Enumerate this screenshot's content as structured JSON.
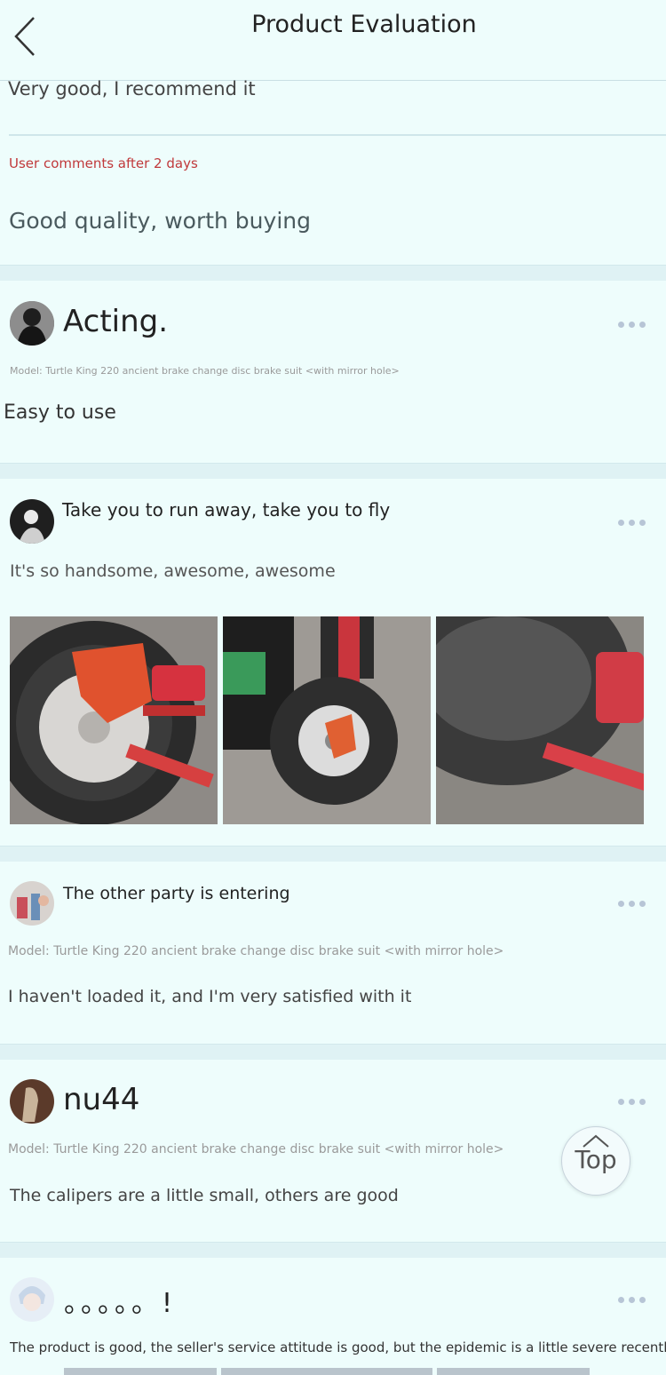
{
  "header": {
    "title": "Product Evaluation"
  },
  "top_review": {
    "text": "Very good, I recommend it",
    "followup_label": "User comments after 2 days",
    "followup_text": "Good quality, worth buying"
  },
  "reviews": [
    {
      "username": "Acting.",
      "model": "Model: Turtle King 220 ancient brake change disc brake suit <with mirror hole>",
      "text": "Easy to use"
    },
    {
      "username": "Take you to run away, take you to fly",
      "text": "It's so handsome, awesome, awesome",
      "images": [
        "caliper-wheel-photo",
        "scooter-disc-photo",
        "tire-closeup-photo"
      ]
    },
    {
      "username": "The other party is entering",
      "model": "Model: Turtle King 220 ancient brake change disc brake suit <with mirror hole>",
      "text": "I haven't loaded it, and I'm very satisfied with it"
    },
    {
      "username": "nu44",
      "model": "Model: Turtle King 220 ancient brake change disc brake suit <with mirror hole>",
      "text": "The calipers are a little small, others are good"
    },
    {
      "username": "。。。。。!",
      "text": "The product is good, the seller's service attitude is good, but the epidemic is a little severe recently."
    }
  ],
  "top_button": {
    "label": "Top"
  },
  "colors": {
    "background": "#eefdfc",
    "separator": "#dff2f4",
    "followup_label": "#c0393b",
    "more_dots": "#b7c5d6"
  }
}
